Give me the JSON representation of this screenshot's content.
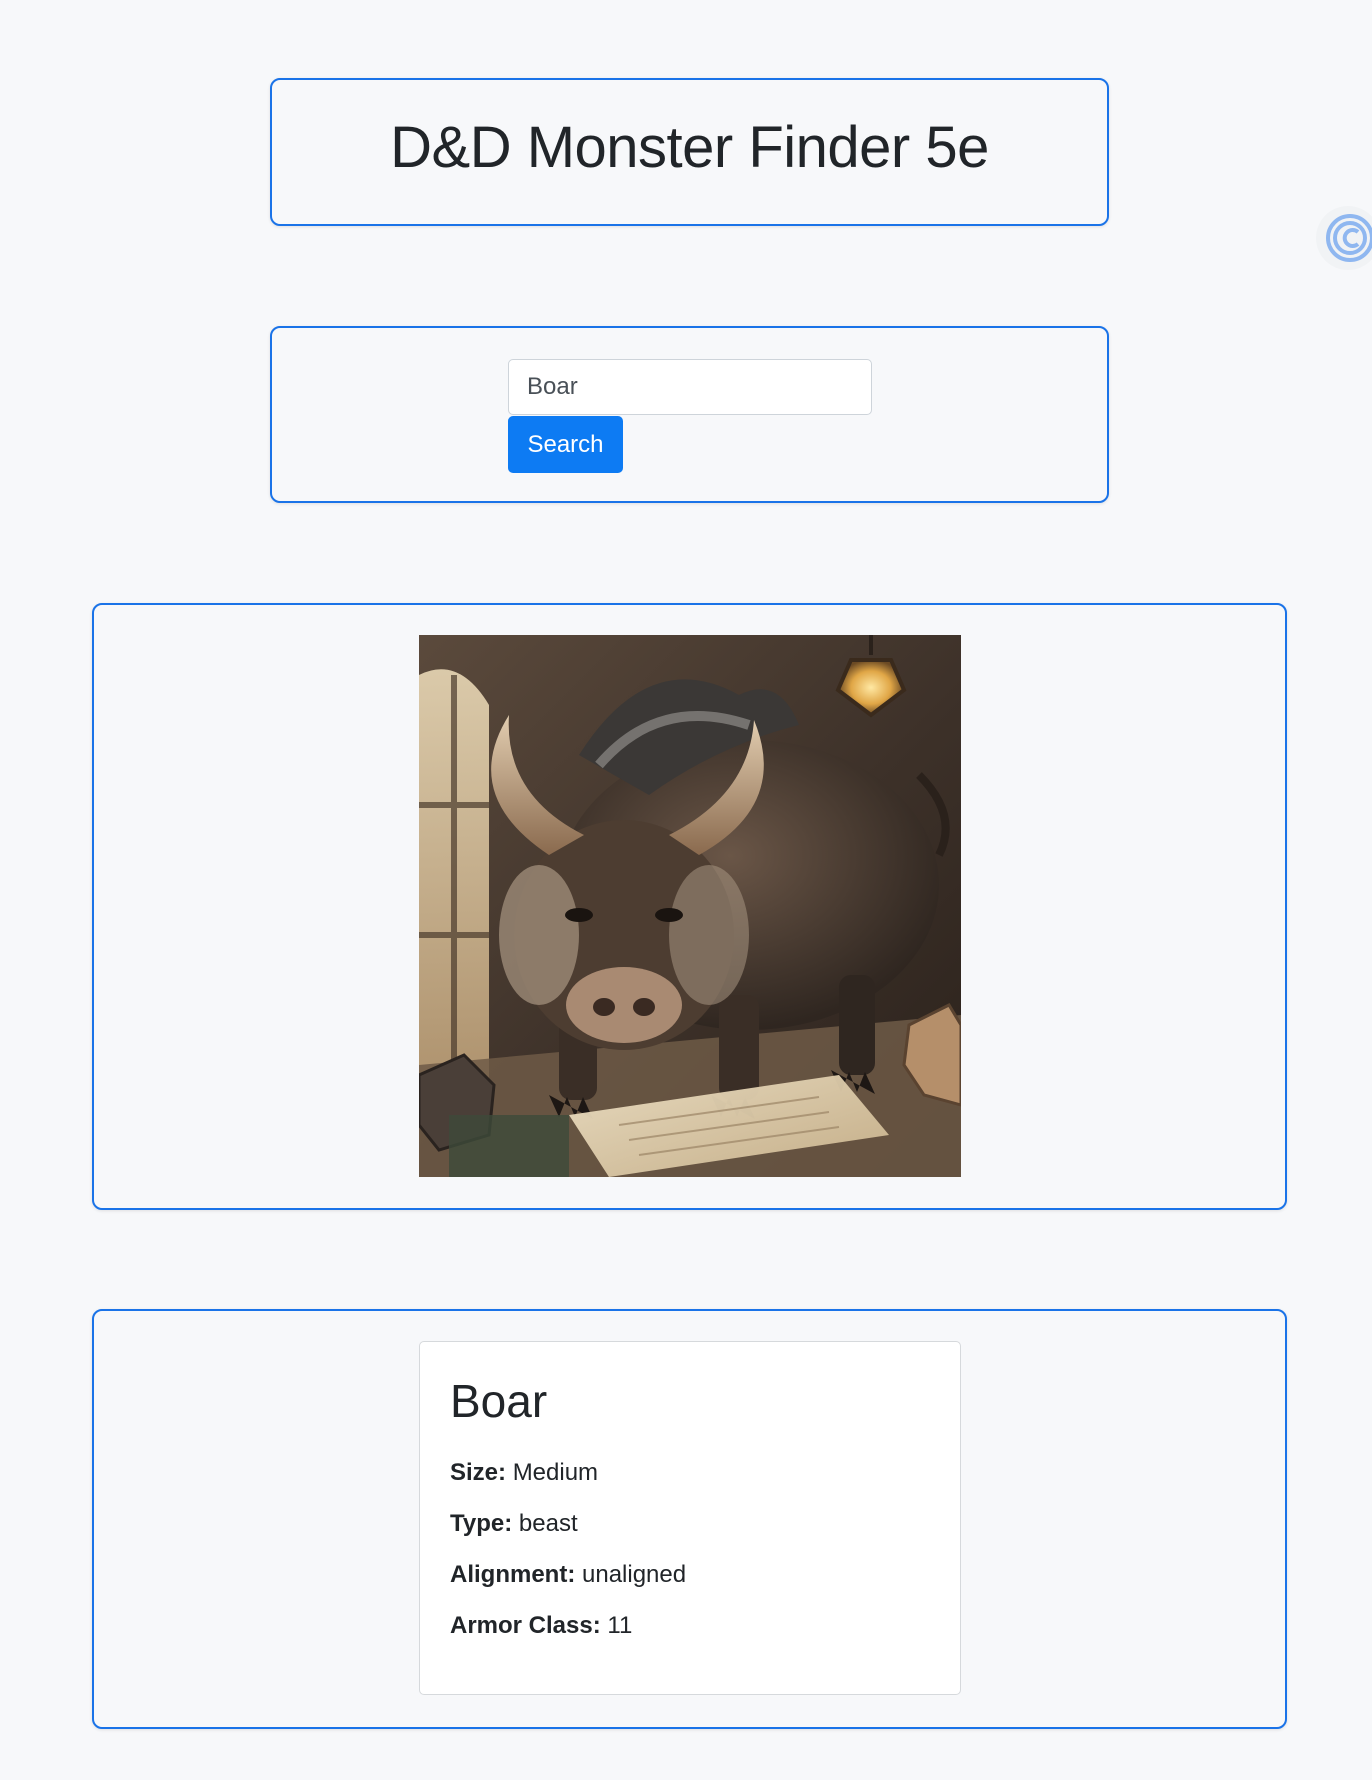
{
  "header": {
    "title": "D&D Monster Finder 5e"
  },
  "search": {
    "value": "Boar",
    "button_label": "Search"
  },
  "monster": {
    "image_alt": "Boar illustration",
    "name": "Boar",
    "stats": [
      {
        "label": "Size:",
        "value": "Medium"
      },
      {
        "label": "Type:",
        "value": "beast"
      },
      {
        "label": "Alignment:",
        "value": "unaligned"
      },
      {
        "label": "Armor Class:",
        "value": "11"
      }
    ]
  },
  "colors": {
    "background": "#f7f8fa",
    "panel_border": "#1a73e8",
    "button": "#0d7bf3"
  },
  "extension": {
    "icon": "extension-c-icon"
  }
}
